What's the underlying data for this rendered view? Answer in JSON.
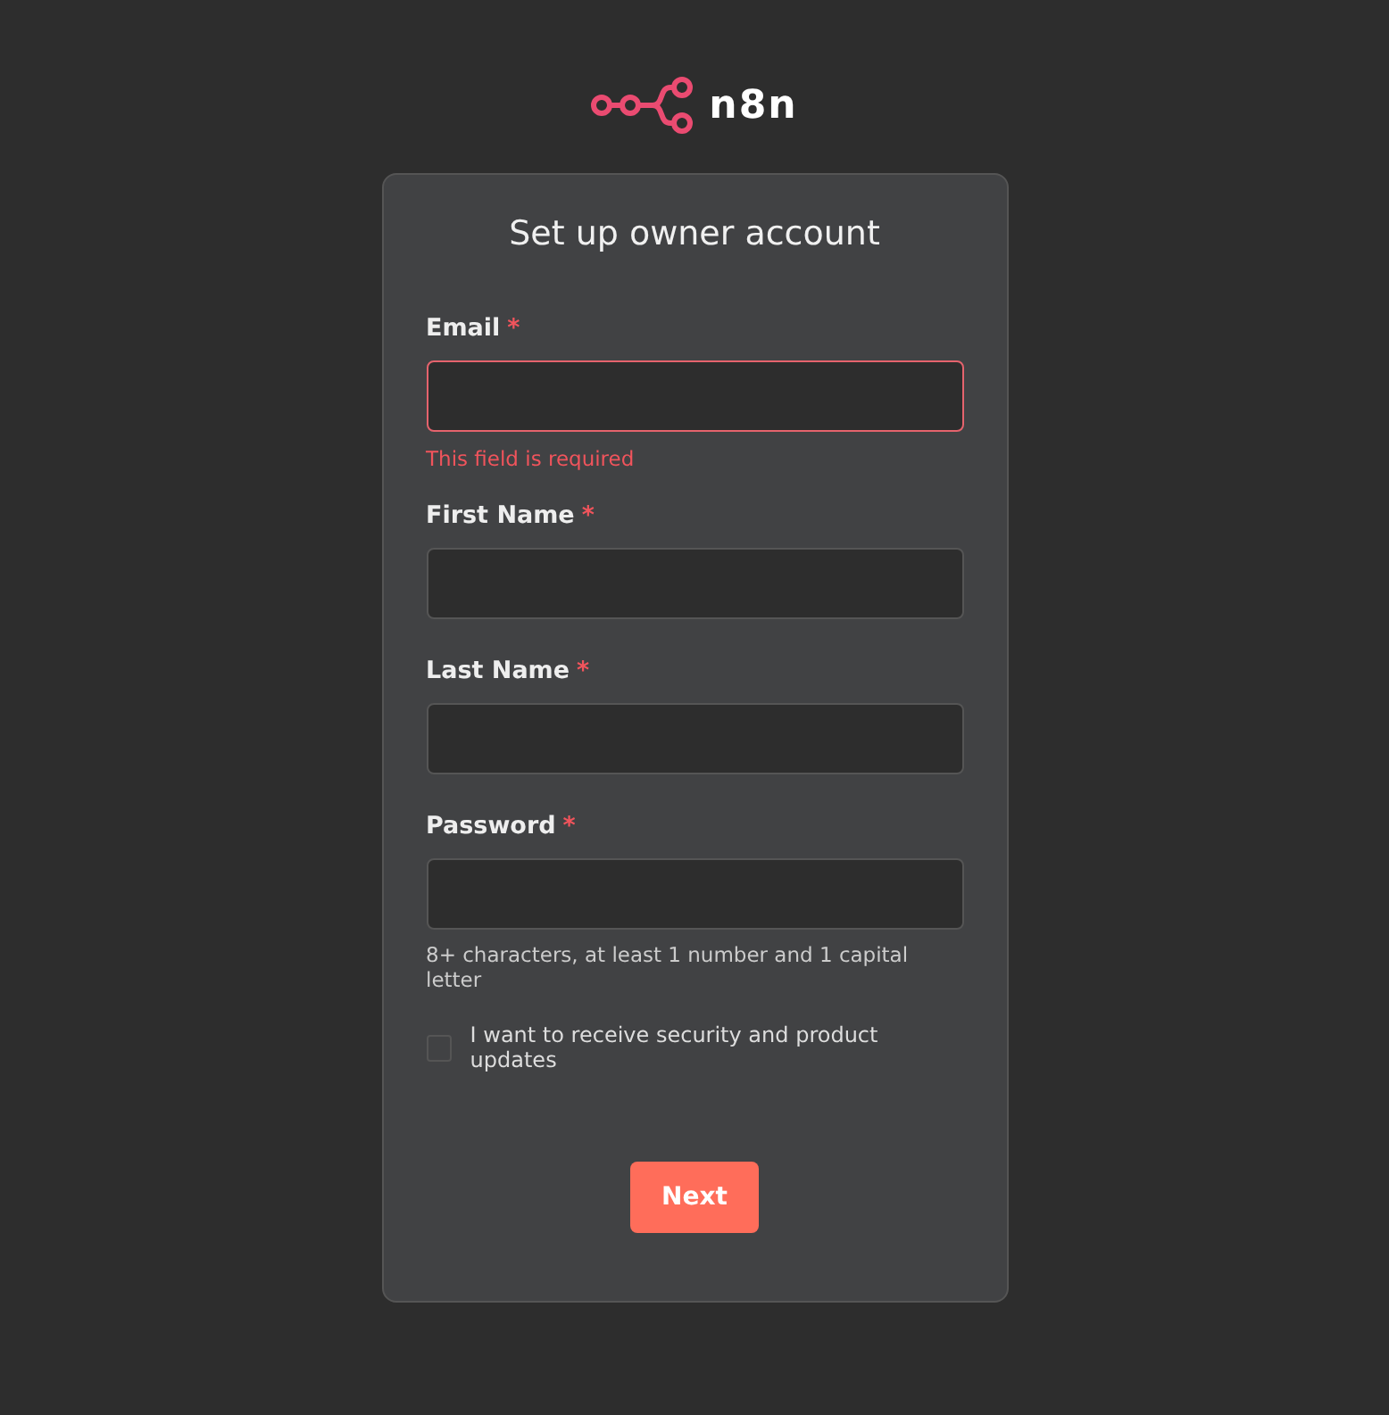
{
  "logo": {
    "wordmark": "n8n"
  },
  "card": {
    "title": "Set up owner account",
    "fields": [
      {
        "label": "Email",
        "required_mark": "*",
        "invalid": true,
        "error": "This field is required"
      },
      {
        "label": "First Name",
        "required_mark": "*",
        "invalid": false
      },
      {
        "label": "Last Name",
        "required_mark": "*",
        "invalid": false
      },
      {
        "label": "Password",
        "required_mark": "*",
        "invalid": false,
        "hint": "8+ characters, at least 1 number and 1 capital letter"
      }
    ],
    "checkbox": {
      "label": "I want to receive security and product updates",
      "checked": false
    },
    "button": "Next"
  }
}
